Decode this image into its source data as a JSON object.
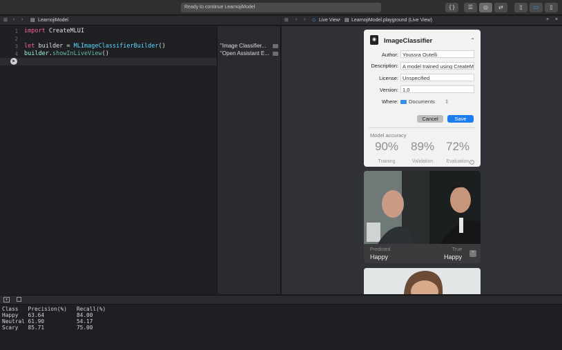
{
  "toolbar": {
    "status": "Ready to continue LearnojiModel",
    "braces_label": "{ }"
  },
  "editor_jumpbar": {
    "file": "LearnojiModel"
  },
  "live_jumpbar": {
    "mode": "Live View",
    "file": "LearnojiModel.playground (Live View)"
  },
  "code_lines": [
    {
      "num": "1",
      "text": "import CreateMLUI"
    },
    {
      "num": "2",
      "text": ""
    },
    {
      "num": "3",
      "text": "let builder = MLImageClassifierBuilder()"
    },
    {
      "num": "4",
      "text": "builder.showInLiveView()"
    }
  ],
  "results": [
    {
      "text": "\"Image Classifier..."
    },
    {
      "text": "\"Open Assistant E..."
    }
  ],
  "classifier": {
    "title": "ImageClassifier",
    "author_label": "Author:",
    "author_value": "Youssra Outelli",
    "description_label": "Description:",
    "description_value": "A model trained using CreateML",
    "license_label": "License:",
    "license_value": "Unspecified",
    "version_label": "Version:",
    "version_value": "1.0",
    "where_label": "Where:",
    "where_value": "Documents",
    "cancel_label": "Cancel",
    "save_label": "Save",
    "accuracy_title": "Model accuracy",
    "metrics": [
      {
        "value": "90%",
        "label": "Training"
      },
      {
        "value": "89%",
        "label": "Validation"
      },
      {
        "value": "72%",
        "label": "Evaluation"
      }
    ]
  },
  "prediction": {
    "predicted_label": "Predicted",
    "predicted_value": "Happy",
    "true_label": "True",
    "true_value": "Happy"
  },
  "console": {
    "header": "Class   Precision(%)   Recall(%)",
    "rows": [
      "Happy   63.64          84.00",
      "Neutral 61.90          54.17",
      "Scary   85.71          75.00"
    ]
  },
  "colors": {
    "accent": "#1b7cf0",
    "keyword": "#fc5fa3",
    "type": "#5dd8ff"
  }
}
